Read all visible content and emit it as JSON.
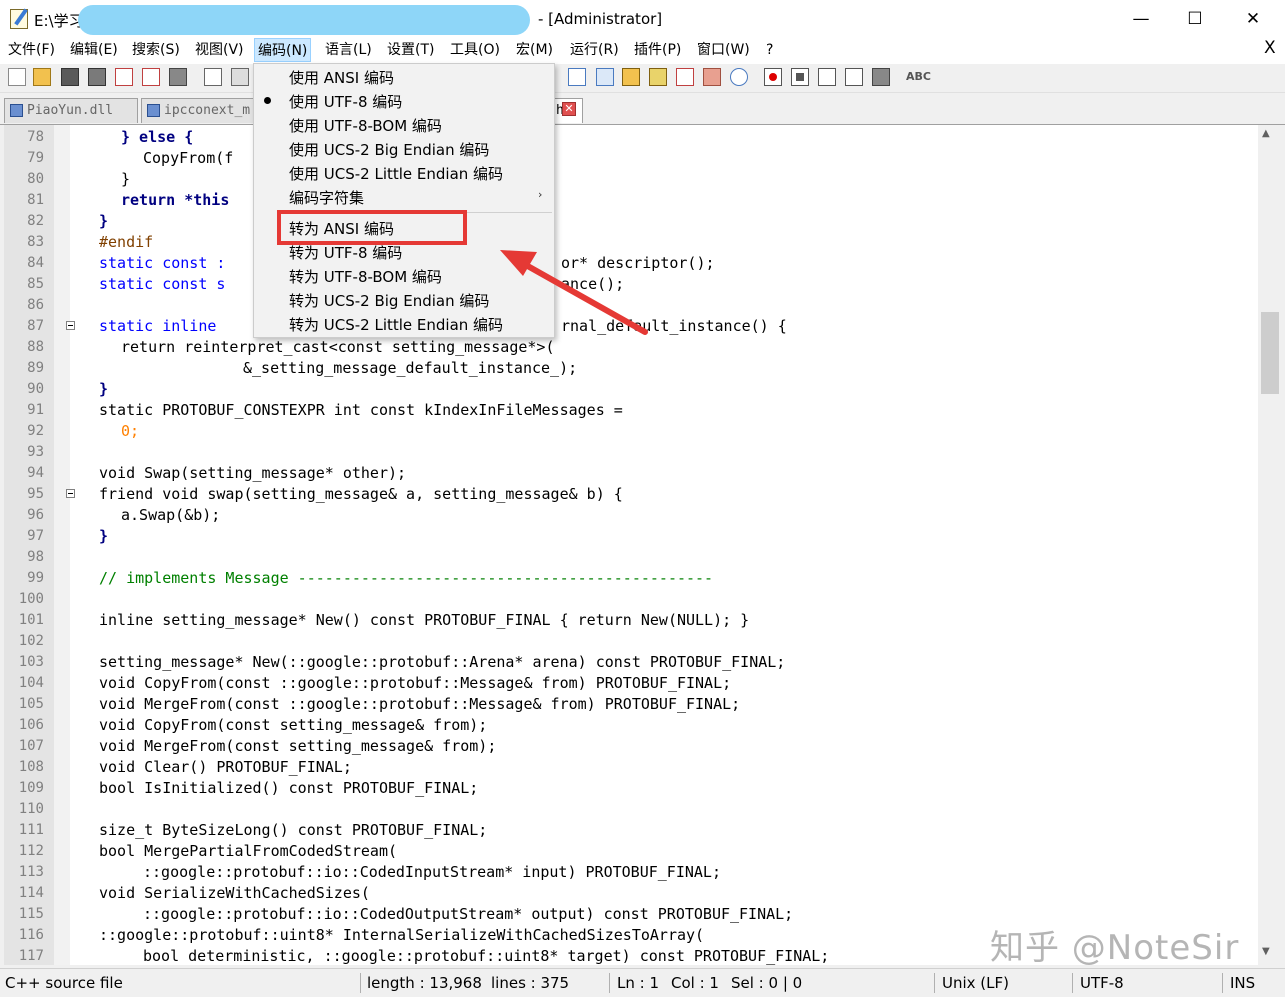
{
  "window": {
    "title_prefix": "E:\\学习",
    "title_suffix": "- [Administrator]",
    "minimize": "—",
    "maximize": "☐",
    "close": "✕"
  },
  "menu": {
    "items": [
      "文件(F)",
      "编辑(E)",
      "搜索(S)",
      "视图(V)",
      "编码(N)",
      "语言(L)",
      "设置(T)",
      "工具(O)",
      "宏(M)",
      "运行(R)",
      "插件(P)",
      "窗口(W)",
      "?"
    ],
    "close_doc": "X",
    "active": "编码(N)"
  },
  "tabs": [
    {
      "label": "PiaoYun.dll"
    },
    {
      "label": "ipcconext_m"
    },
    {
      "label": "h"
    }
  ],
  "encoding_menu": {
    "items": [
      "使用 ANSI 编码",
      "使用 UTF-8 编码",
      "使用 UTF-8-BOM 编码",
      "使用 UCS-2 Big Endian 编码",
      "使用 UCS-2 Little Endian 编码",
      "编码字符集",
      "转为 ANSI 编码",
      "转为 UTF-8 编码",
      "转为 UTF-8-BOM 编码",
      "转为 UCS-2 Big Endian 编码",
      "转为 UCS-2 Little Endian 编码"
    ],
    "checked": "使用 UTF-8 编码",
    "highlighted": "转为 ANSI 编码",
    "submenu_arrow": "›"
  },
  "editor": {
    "line_numbers": [
      "78",
      "79",
      "80",
      "81",
      "82",
      "83",
      "84",
      "85",
      "86",
      "87",
      "88",
      "89",
      "90",
      "91",
      "92",
      "93",
      "94",
      "95",
      "96",
      "97",
      "98",
      "99",
      "100",
      "101",
      "102",
      "103",
      "104",
      "105",
      "106",
      "107",
      "108",
      "109",
      "110",
      "111",
      "112",
      "113",
      "114",
      "115",
      "116",
      "117"
    ],
    "visible_code": {
      "l78": "} else {",
      "l79": "CopyFrom(f",
      "l80": "}",
      "l81": "return *this",
      "l82": "}",
      "l83": "#endif",
      "l84a": "static const :",
      "l84b": "or* descriptor();",
      "l85a": "static const s",
      "l85b": "ance();",
      "l87a": "static inline",
      "l87b": "rnal_default_instance() {",
      "l88": "return reinterpret_cast<const setting_message*>(",
      "l89": "&_setting_message_default_instance_);",
      "l90": "}",
      "l91": "static PROTOBUF_CONSTEXPR int const kIndexInFileMessages =",
      "l92": "0;",
      "l94": "void Swap(setting_message* other);",
      "l95": "friend void swap(setting_message& a, setting_message& b) {",
      "l96": "a.Swap(&b);",
      "l97": "}",
      "l99": "// implements Message ----------------------------------------------",
      "l101": "inline setting_message* New() const PROTOBUF_FINAL { return New(NULL); }",
      "l103": "setting_message* New(::google::protobuf::Arena* arena) const PROTOBUF_FINAL;",
      "l104": "void CopyFrom(const ::google::protobuf::Message& from) PROTOBUF_FINAL;",
      "l105": "void MergeFrom(const ::google::protobuf::Message& from) PROTOBUF_FINAL;",
      "l106": "void CopyFrom(const setting_message& from);",
      "l107": "void MergeFrom(const setting_message& from);",
      "l108": "void Clear() PROTOBUF_FINAL;",
      "l109": "bool IsInitialized() const PROTOBUF_FINAL;",
      "l111": "size_t ByteSizeLong() const PROTOBUF_FINAL;",
      "l112": "bool MergePartialFromCodedStream(",
      "l113": "::google::protobuf::io::CodedInputStream* input) PROTOBUF_FINAL;",
      "l114": "void SerializeWithCachedSizes(",
      "l115": "::google::protobuf::io::CodedOutputStream* output) const PROTOBUF_FINAL;",
      "l116": "::google::protobuf::uint8* InternalSerializeWithCachedSizesToArray(",
      "l117": "bool deterministic, ::google::protobuf::uint8* target) const PROTOBUF_FINAL;"
    }
  },
  "watermark": "知乎 @NoteSir",
  "status": {
    "filetype": "C++ source file",
    "length": "length : 13,968",
    "lines": "lines : 375",
    "ln": "Ln : 1",
    "col": "Col : 1",
    "sel": "Sel : 0 | 0",
    "eol": "Unix (LF)",
    "encoding": "UTF-8",
    "mode": "INS"
  },
  "colors": {
    "keyword": "#0000ff",
    "bold_keyword": "#000080",
    "comment": "#008000",
    "preprocessor": "#804000",
    "number": "#ff8000",
    "highlight": "#e53935",
    "menu_active": "#cce8ff"
  }
}
